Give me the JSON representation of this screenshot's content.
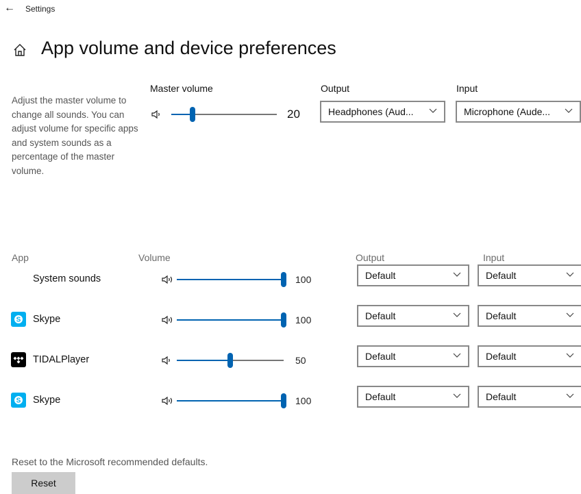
{
  "window": {
    "title": "Settings"
  },
  "page": {
    "title": "App volume and device preferences",
    "description": "Adjust the master volume to change all sounds. You can adjust volume for specific apps and system sounds as a percentage of the master volume."
  },
  "master": {
    "label": "Master volume",
    "value": 20,
    "value_text": "20",
    "output_label": "Output",
    "output_value": "Headphones (Aud...",
    "input_label": "Input",
    "input_value": "Microphone (Aude..."
  },
  "columns": {
    "app": "App",
    "volume": "Volume",
    "output": "Output",
    "input": "Input"
  },
  "apps": [
    {
      "name": "System sounds",
      "icon": "none",
      "volume": 100,
      "volume_text": "100",
      "output": "Default",
      "input": "Default"
    },
    {
      "name": "Skype",
      "icon": "skype-icon",
      "volume": 100,
      "volume_text": "100",
      "output": "Default",
      "input": "Default"
    },
    {
      "name": "TIDALPlayer",
      "icon": "tidal-icon",
      "volume": 50,
      "volume_text": "50",
      "output": "Default",
      "input": "Default"
    },
    {
      "name": "Skype",
      "icon": "skype-icon",
      "volume": 100,
      "volume_text": "100",
      "output": "Default",
      "input": "Default"
    }
  ],
  "reset": {
    "text": "Reset to the Microsoft recommended defaults.",
    "button_label": "Reset"
  },
  "colors": {
    "accent": "#0063b1",
    "skype": "#00aff0",
    "tidal": "#000000"
  }
}
